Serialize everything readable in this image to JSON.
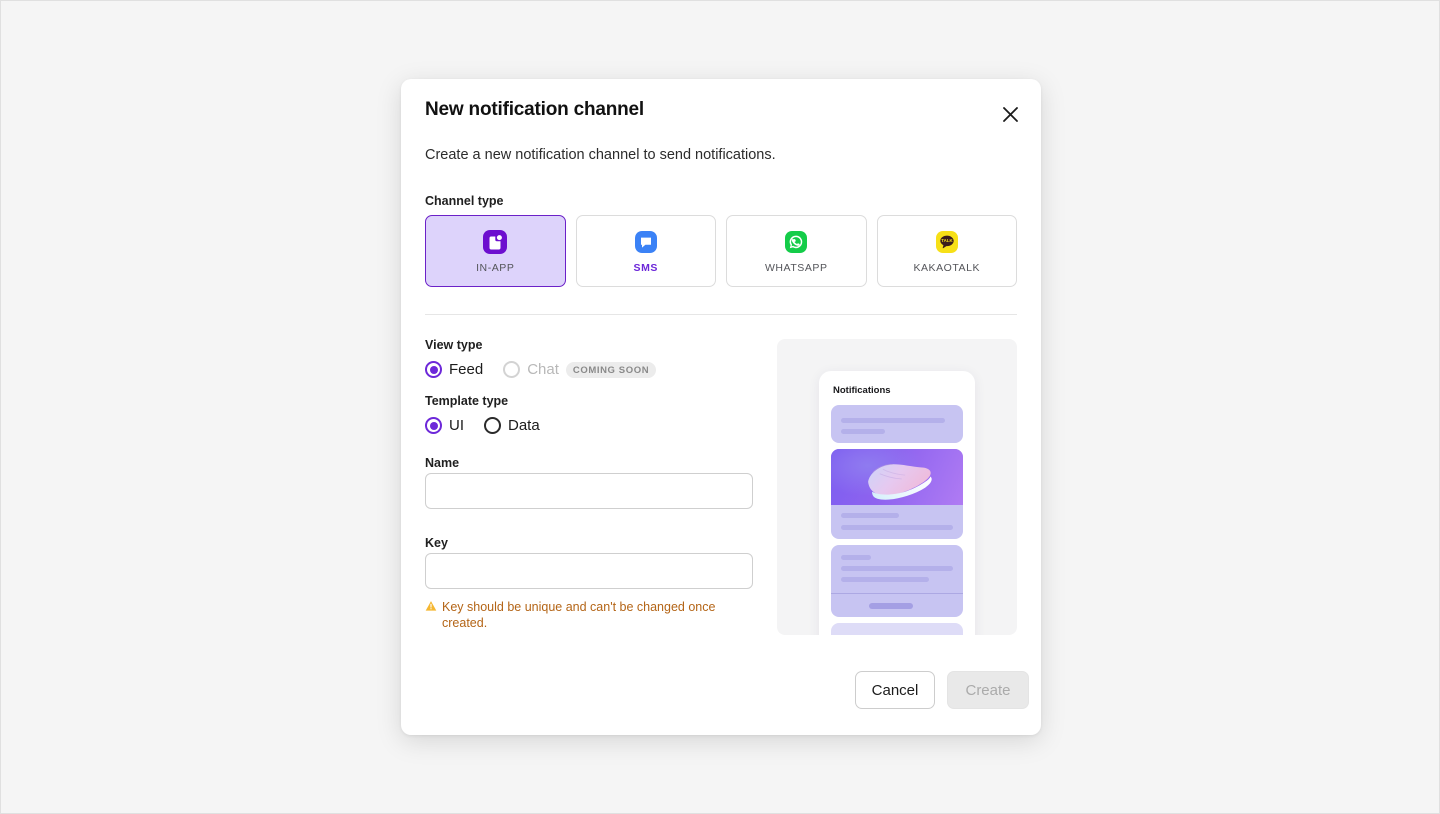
{
  "modal": {
    "title": "New notification channel",
    "description": "Create a new notification channel to send notifications.",
    "close_icon": "close-icon"
  },
  "channel_type": {
    "label": "Channel type",
    "options": [
      {
        "label": "IN-APP",
        "icon": "in-app-icon",
        "selected": true,
        "accent": false
      },
      {
        "label": "SMS",
        "icon": "sms-icon",
        "selected": false,
        "accent": true
      },
      {
        "label": "WHATSAPP",
        "icon": "whatsapp-icon",
        "selected": false,
        "accent": false
      },
      {
        "label": "KAKAOTALK",
        "icon": "kakaotalk-icon",
        "selected": false,
        "accent": false
      }
    ]
  },
  "view_type": {
    "label": "View type",
    "options": [
      {
        "label": "Feed",
        "selected": true,
        "disabled": false,
        "badge": null
      },
      {
        "label": "Chat",
        "selected": false,
        "disabled": true,
        "badge": "COMING SOON"
      }
    ]
  },
  "template_type": {
    "label": "Template type",
    "options": [
      {
        "label": "UI",
        "selected": true,
        "disabled": false
      },
      {
        "label": "Data",
        "selected": false,
        "disabled": false
      }
    ]
  },
  "name_field": {
    "label": "Name",
    "value": "",
    "placeholder": ""
  },
  "key_field": {
    "label": "Key",
    "value": "",
    "placeholder": "",
    "hint": "Key should be unique and can't be changed once created.",
    "hint_icon": "warning-triangle-icon",
    "hint_color": "#b46517"
  },
  "preview": {
    "phone_title": "Notifications"
  },
  "footer": {
    "cancel_label": "Cancel",
    "create_label": "Create",
    "create_disabled": true
  },
  "colors": {
    "accent": "#6d28d9",
    "selected_card_bg": "#ddd3fb",
    "page_bg": "#f5f5f5",
    "warning": "#b46517"
  }
}
